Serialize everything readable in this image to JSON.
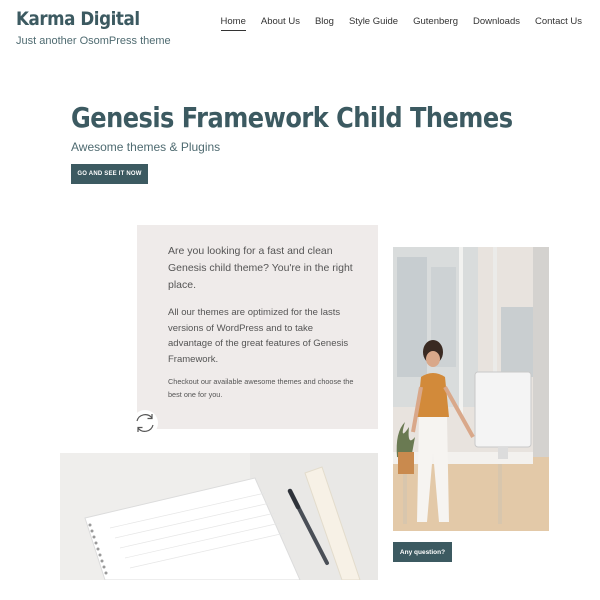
{
  "site": {
    "title": "Karma Digital",
    "description": "Just another OsomPress theme"
  },
  "nav": {
    "items": [
      {
        "label": "Home",
        "active": true
      },
      {
        "label": "About Us",
        "active": false
      },
      {
        "label": "Blog",
        "active": false
      },
      {
        "label": "Style Guide",
        "active": false
      },
      {
        "label": "Gutenberg",
        "active": false
      },
      {
        "label": "Downloads",
        "active": false
      },
      {
        "label": "Contact Us",
        "active": false
      }
    ]
  },
  "hero": {
    "title": "Genesis Framework Child Themes",
    "subtitle": "Awesome themes & Plugins",
    "cta_label": "GO AND SEE IT NOW"
  },
  "card": {
    "paragraph1": "Are you looking for a fast and clean Genesis child theme? You're in the right place.",
    "paragraph2": "All our themes are optimized for the lasts versions of WordPress and to take advantage of the great features of Genesis Framework.",
    "paragraph3": "Checkout our available awesome themes and choose the best one for you."
  },
  "images": {
    "woman_alt": "Woman working at a desk with a computer",
    "notebook_alt": "Notebook with pen and ruler"
  },
  "question_button": "Any question?",
  "colors": {
    "brand": "#3c5a61",
    "card_bg": "#efebea"
  }
}
